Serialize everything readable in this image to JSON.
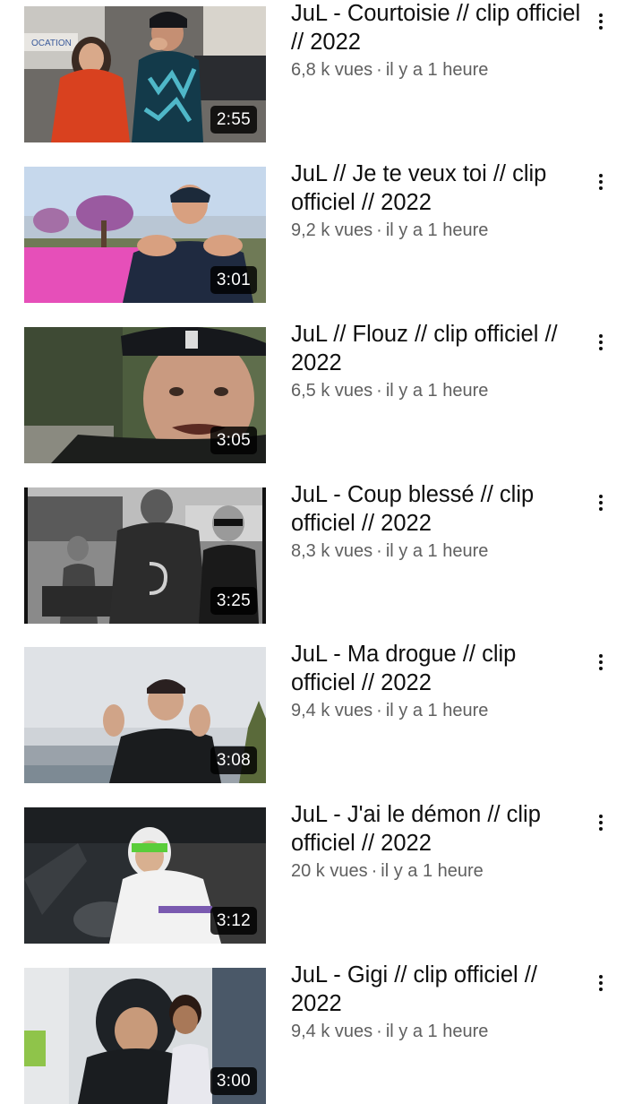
{
  "colors": {
    "title": "#0f0f0f",
    "meta": "#606060",
    "duration_bg": "#000000",
    "duration_text": "#ffffff"
  },
  "videos": [
    {
      "title": "JuL - Courtoisie // clip officiel // 2022",
      "views": "6,8 k vues",
      "age": "il y a 1 heure",
      "duration": "2:55",
      "menu_icon": "more-vert-icon"
    },
    {
      "title": "JuL // Je te veux toi // clip officiel // 2022",
      "views": "9,2 k vues",
      "age": "il y a 1 heure",
      "duration": "3:01",
      "menu_icon": "more-vert-icon"
    },
    {
      "title": "JuL // Flouz // clip officiel // 2022",
      "views": "6,5 k vues",
      "age": "il y a 1 heure",
      "duration": "3:05",
      "menu_icon": "more-vert-icon"
    },
    {
      "title": "JuL - Coup blessé // clip officiel // 2022",
      "views": "8,3 k vues",
      "age": "il y a 1 heure",
      "duration": "3:25",
      "menu_icon": "more-vert-icon"
    },
    {
      "title": "JuL - Ma drogue // clip officiel // 2022",
      "views": "9,4 k vues",
      "age": "il y a 1 heure",
      "duration": "3:08",
      "menu_icon": "more-vert-icon"
    },
    {
      "title": "JuL - J'ai le démon // clip officiel // 2022",
      "views": "20 k vues",
      "age": "il y a 1 heure",
      "duration": "3:12",
      "menu_icon": "more-vert-icon"
    },
    {
      "title": "JuL - Gigi // clip officiel // 2022",
      "views": "9,4 k vues",
      "age": "il y a 1 heure",
      "duration": "3:00",
      "menu_icon": "more-vert-icon"
    }
  ]
}
